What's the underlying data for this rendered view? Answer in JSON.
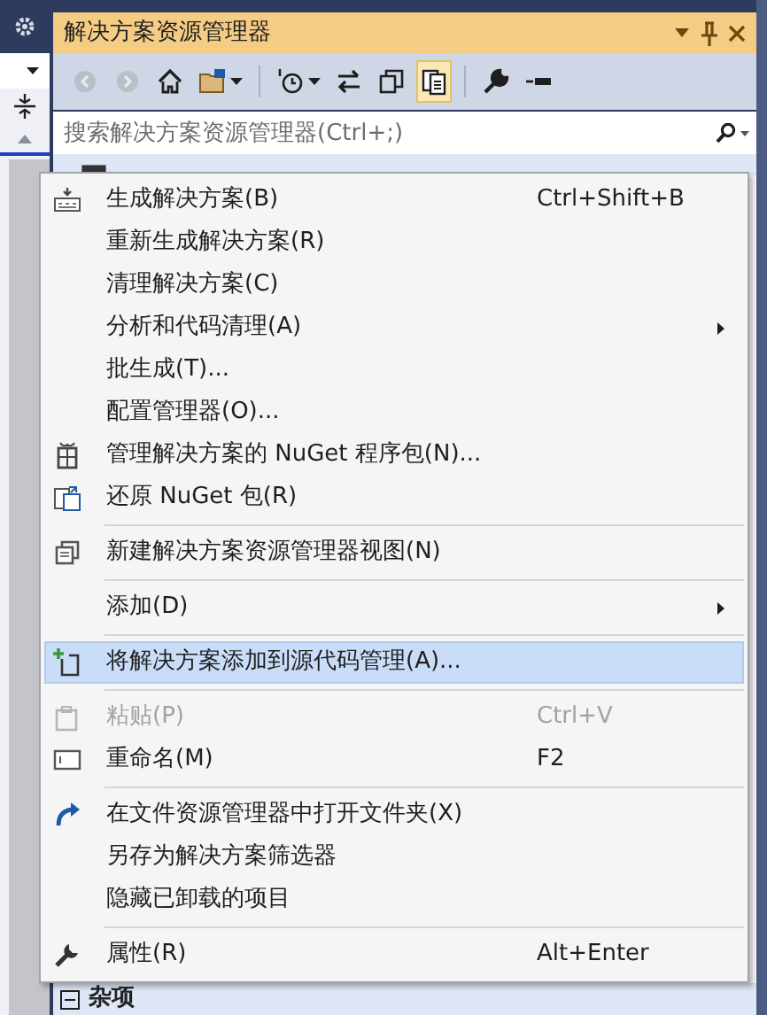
{
  "panel": {
    "title": "解决方案资源管理器"
  },
  "title_buttons": [
    {
      "kind": "dropdown"
    },
    {
      "kind": "pin"
    },
    {
      "kind": "close"
    }
  ],
  "toolbar": [
    {
      "kind": "back",
      "disabled": true,
      "selected": false
    },
    {
      "kind": "forward",
      "disabled": true,
      "selected": false
    },
    {
      "kind": "home",
      "disabled": false,
      "selected": false
    },
    {
      "kind": "sync",
      "disabled": false,
      "selected": false
    },
    {
      "kind": "separator"
    },
    {
      "kind": "history",
      "disabled": false,
      "selected": false
    },
    {
      "kind": "swap",
      "disabled": false,
      "selected": false
    },
    {
      "kind": "collapse",
      "disabled": false,
      "selected": false
    },
    {
      "kind": "showall",
      "disabled": false,
      "selected": true
    },
    {
      "kind": "separator"
    },
    {
      "kind": "wrench",
      "disabled": false,
      "selected": false
    },
    {
      "kind": "preview",
      "disabled": false,
      "selected": false
    }
  ],
  "search": {
    "placeholder": "搜索解决方案资源管理器(Ctrl+;)"
  },
  "menu": [
    {
      "kind": "item",
      "label": "生成解决方案(B)",
      "shortcut": "Ctrl+Shift+B",
      "submenu": false,
      "disabled": false,
      "selected": false
    },
    {
      "kind": "item",
      "label": "重新生成解决方案(R)",
      "submenu": false,
      "disabled": false,
      "selected": false
    },
    {
      "kind": "item",
      "label": "清理解决方案(C)",
      "submenu": false,
      "disabled": false,
      "selected": false
    },
    {
      "kind": "item",
      "label": "分析和代码清理(A)",
      "submenu": true,
      "disabled": false,
      "selected": false
    },
    {
      "kind": "item",
      "label": "批生成(T)...",
      "submenu": false,
      "disabled": false,
      "selected": false
    },
    {
      "kind": "item",
      "label": "配置管理器(O)...",
      "submenu": false,
      "disabled": false,
      "selected": false
    },
    {
      "kind": "item",
      "label": "管理解决方案的 NuGet 程序包(N)...",
      "submenu": false,
      "disabled": false,
      "selected": false
    },
    {
      "kind": "item",
      "label": "还原 NuGet 包(R)",
      "submenu": false,
      "disabled": false,
      "selected": false
    },
    {
      "kind": "separator"
    },
    {
      "kind": "item",
      "label": "新建解决方案资源管理器视图(N)",
      "submenu": false,
      "disabled": false,
      "selected": false
    },
    {
      "kind": "separator"
    },
    {
      "kind": "item",
      "label": "添加(D)",
      "submenu": true,
      "disabled": false,
      "selected": false
    },
    {
      "kind": "separator"
    },
    {
      "kind": "item",
      "label": "将解决方案添加到源代码管理(A)...",
      "submenu": false,
      "disabled": false,
      "selected": true
    },
    {
      "kind": "separator"
    },
    {
      "kind": "item",
      "label": "粘贴(P)",
      "shortcut": "Ctrl+V",
      "submenu": false,
      "disabled": true,
      "selected": false
    },
    {
      "kind": "item",
      "label": "重命名(M)",
      "shortcut": "F2",
      "submenu": false,
      "disabled": false,
      "selected": false
    },
    {
      "kind": "separator"
    },
    {
      "kind": "item",
      "label": "在文件资源管理器中打开文件夹(X)",
      "submenu": false,
      "disabled": false,
      "selected": false
    },
    {
      "kind": "item",
      "label": "另存为解决方案筛选器",
      "submenu": false,
      "disabled": false,
      "selected": false
    },
    {
      "kind": "item",
      "label": "隐藏已卸载的项目",
      "submenu": false,
      "disabled": false,
      "selected": false
    },
    {
      "kind": "separator"
    },
    {
      "kind": "item",
      "label": "属性(R)",
      "shortcut": "Alt+Enter",
      "submenu": false,
      "disabled": false,
      "selected": false
    }
  ],
  "tree": [
    {
      "label": "杂项",
      "expanded": true
    }
  ]
}
